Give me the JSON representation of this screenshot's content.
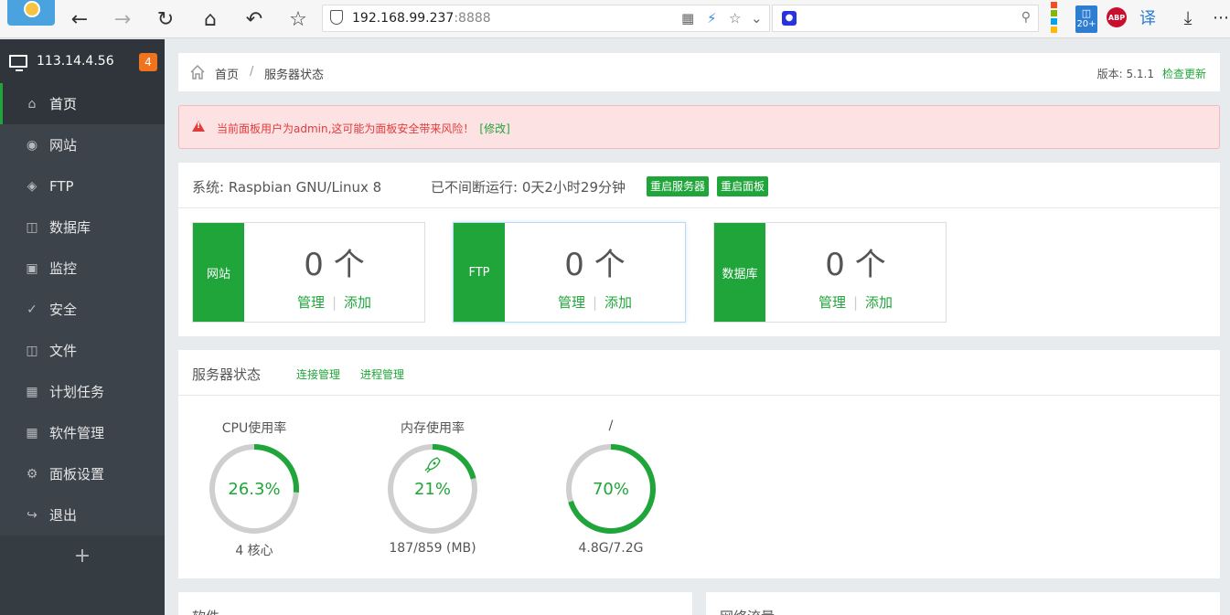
{
  "browser": {
    "url_host": "192.168.99.237",
    "url_port": ":8888",
    "ext_badge": "20+",
    "ext_abp": "ABP",
    "ext_translate": "译"
  },
  "sidebar": {
    "ip": "113.14.4.56",
    "badge_count": "4",
    "items": [
      {
        "label": "首页",
        "icon": "home-icon"
      },
      {
        "label": "网站",
        "icon": "globe-icon"
      },
      {
        "label": "FTP",
        "icon": "ftp-icon"
      },
      {
        "label": "数据库",
        "icon": "database-icon"
      },
      {
        "label": "监控",
        "icon": "monitor-icon"
      },
      {
        "label": "安全",
        "icon": "shield-icon"
      },
      {
        "label": "文件",
        "icon": "folder-icon"
      },
      {
        "label": "计划任务",
        "icon": "calendar-icon"
      },
      {
        "label": "软件管理",
        "icon": "apps-icon"
      },
      {
        "label": "面板设置",
        "icon": "gear-icon"
      },
      {
        "label": "退出",
        "icon": "logout-icon"
      }
    ],
    "add_label": "+"
  },
  "breadcrumb": {
    "home": "首页",
    "separator": "/",
    "current": "服务器状态",
    "version": "版本: 5.1.1",
    "check_update": "检查更新"
  },
  "alert": {
    "message": "当前面板用户为admin,这可能为面板安全带来风险！",
    "fix_link": "[修改]"
  },
  "system": {
    "os": "系统: Raspbian GNU/Linux 8",
    "uptime": "已不间断运行: 0天2小时29分钟",
    "restart_server": "重启服务器",
    "restart_panel": "重启面板"
  },
  "cards": [
    {
      "tag": "网站",
      "count": "0 个",
      "manage": "管理",
      "add": "添加"
    },
    {
      "tag": "FTP",
      "count": "0 个",
      "manage": "管理",
      "add": "添加"
    },
    {
      "tag": "数据库",
      "count": "0 个",
      "manage": "管理",
      "add": "添加"
    }
  ],
  "status": {
    "title": "服务器状态",
    "link_connections": "连接管理",
    "link_processes": "进程管理",
    "gauges": [
      {
        "title": "CPU使用率",
        "value": "26.3%",
        "fraction": 0.263,
        "sub": "4 核心"
      },
      {
        "title": "内存使用率",
        "value": "21%",
        "fraction": 0.21,
        "sub": "187/859 (MB)"
      },
      {
        "title": "/",
        "value": "70%",
        "fraction": 0.7,
        "sub": "4.8G/7.2G"
      }
    ]
  },
  "bottom": {
    "left_title": "软件",
    "right_title": "网络流量"
  },
  "colors": {
    "accent": "#20a53a",
    "sidebar": "#3c434a",
    "alert_text": "#e03c3c",
    "badge": "#f0741e"
  }
}
